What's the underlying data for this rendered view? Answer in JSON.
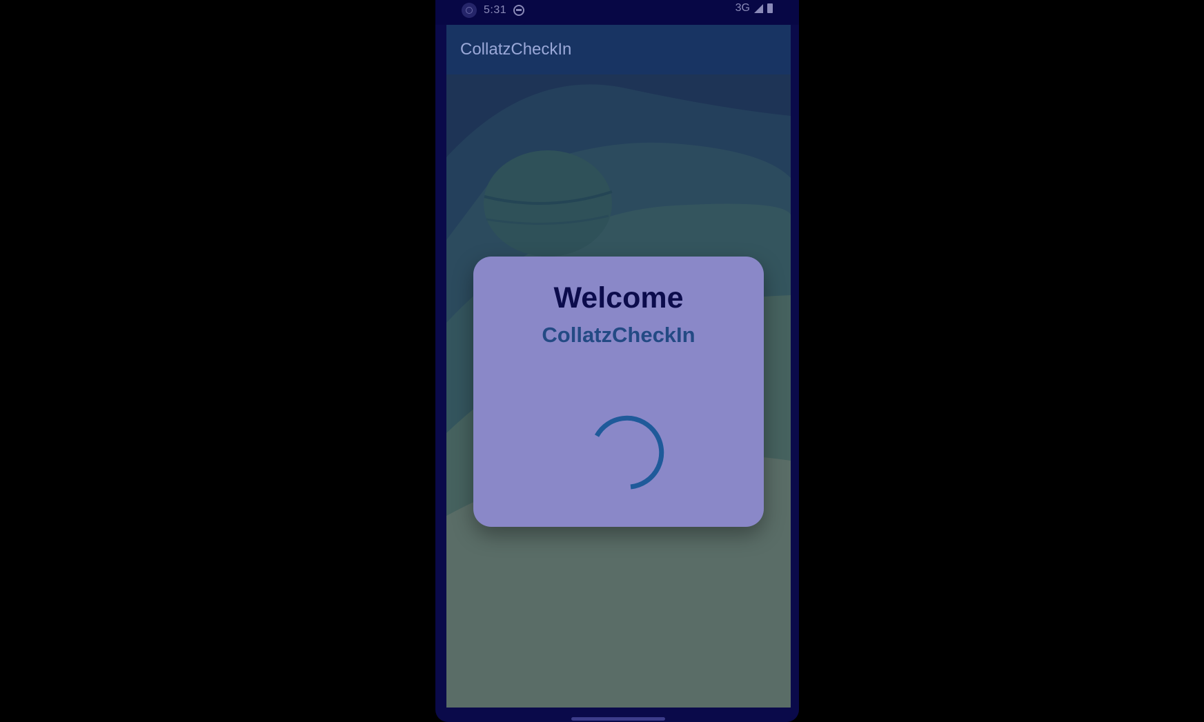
{
  "status_bar": {
    "time": "5:31",
    "network": "3G",
    "icons": [
      "circle-icon",
      "sync-icon",
      "signal-icon",
      "battery-icon"
    ]
  },
  "app_bar": {
    "title": "CollatzCheckIn"
  },
  "dialog": {
    "title": "Welcome",
    "subtitle": "CollatzCheckIn",
    "indicator": "loading-spinner-icon"
  },
  "colors": {
    "background": "#000000",
    "phone_frame": "#0a0a4a",
    "app_bar": "#183463",
    "dialog": "#8a88c8",
    "dialog_title": "#0c0c4c",
    "dialog_subtitle": "#234a84",
    "spinner": "#1f5a9a"
  }
}
